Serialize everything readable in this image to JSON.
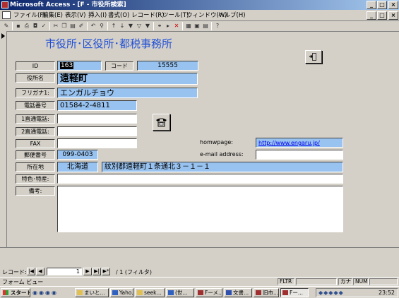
{
  "window": {
    "title": "Microsoft Access - [F - 市役所検索]",
    "min": "_",
    "max": "□",
    "close": "×"
  },
  "menu": [
    {
      "label": "ファイル(F)"
    },
    {
      "label": "編集(E)"
    },
    {
      "label": "表示(V)"
    },
    {
      "label": "挿入(I)"
    },
    {
      "label": "書式(O)"
    },
    {
      "label": "レコード(R)"
    },
    {
      "label": "ツール(T)"
    },
    {
      "label": "ウィンドウ(W)"
    },
    {
      "label": "ヘルプ(H)"
    }
  ],
  "form": {
    "title": "市役所･区役所･都税事務所",
    "id_label": "ID",
    "id_value": "163",
    "code_label": "コード",
    "code_value": "15555",
    "name_label": "役所名",
    "name_value": "遠軽町",
    "furigana_label": "フリガナ1:",
    "furigana_value": "エンガルチョウ",
    "phone_label": "電話番号",
    "phone_value": "01584-2-4811",
    "direct1_label": "1直通電話:",
    "direct1_value": "",
    "direct2_label": "2直通電話:",
    "direct2_value": "",
    "fax_label": "FAX",
    "fax_value": "",
    "homepage_label": "homwpage:",
    "homepage_value": "http://www.engaru.jp/",
    "email_label": "e-mail address:",
    "email_value": "",
    "postal_label": "郵便番号",
    "postal_value": "099-0403",
    "address_label": "所在地",
    "pref_value": "北海道",
    "address_value": "紋別郡遠軽町１条通北３－１－１",
    "feature_label": "特色･特産:",
    "feature_value": "",
    "notes_label": "備考:",
    "notes_value": ""
  },
  "recnav": {
    "label": "レコード:",
    "current": "1",
    "total": "/ 1 (フィルタ)"
  },
  "status": {
    "view": "フォーム ビュー",
    "fltr": "FLTR",
    "kana": "カナ",
    "num": "NUM"
  },
  "taskbar": {
    "start": "スタート",
    "clock": "23:52",
    "items": [
      {
        "label": "まいと..."
      },
      {
        "label": "Yaho..."
      },
      {
        "label": "seek..."
      },
      {
        "label": "(世..."
      },
      {
        "label": "Fーメ..."
      },
      {
        "label": "文書..."
      },
      {
        "label": "旧市..."
      },
      {
        "label": "Fー..."
      }
    ]
  },
  "colors": {
    "field_blue": "#98c2ef",
    "title_blue": "#1f4fd6",
    "titlebar": "#0a246a"
  }
}
